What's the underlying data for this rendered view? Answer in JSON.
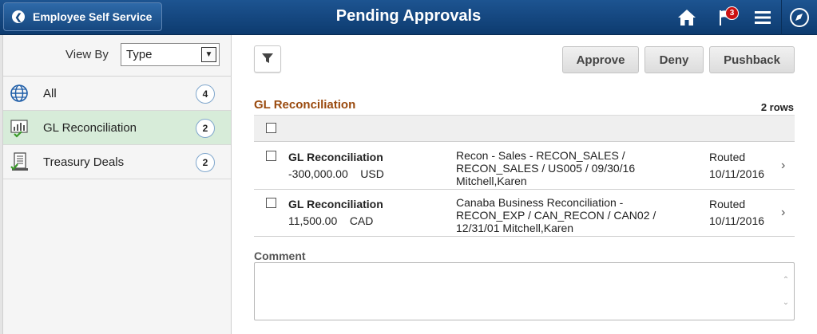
{
  "header": {
    "back_label": "Employee Self Service",
    "title": "Pending Approvals",
    "notification_count": "3",
    "icons": [
      "home-icon",
      "flag-icon",
      "menu-icon",
      "navbar-icon"
    ]
  },
  "sidebar": {
    "view_by_label": "View By",
    "view_by_value": "Type",
    "items": [
      {
        "label": "All",
        "count": "4",
        "icon": "globe-icon",
        "selected": false
      },
      {
        "label": "GL Reconciliation",
        "count": "2",
        "icon": "ledger-chart-icon",
        "selected": true
      },
      {
        "label": "Treasury Deals",
        "count": "2",
        "icon": "document-check-icon",
        "selected": false
      }
    ]
  },
  "actions": {
    "approve": "Approve",
    "deny": "Deny",
    "pushback": "Pushback"
  },
  "grid": {
    "title": "GL Reconciliation",
    "row_count": "2 rows",
    "rows": [
      {
        "title": "GL Reconciliation",
        "amount": "-300,000.00",
        "currency": "USD",
        "description": "Recon - Sales -  RECON_SALES / RECON_SALES / US005 / 09/30/16 Mitchell,Karen",
        "status": "Routed",
        "date": "10/11/2016"
      },
      {
        "title": "GL Reconciliation",
        "amount": "11,500.00",
        "currency": "CAD",
        "description": "Canaba Business Reconciliation - RECON_EXP / CAN_RECON / CAN02 / 12/31/01 Mitchell,Karen",
        "status": "Routed",
        "date": "10/11/2016"
      }
    ]
  },
  "comment": {
    "label": "Comment",
    "value": ""
  },
  "colors": {
    "header_bg": "#1d5491",
    "selected_row": "#d7ecd9",
    "grid_title": "#9a4a0e",
    "badge": "#cc1111"
  }
}
